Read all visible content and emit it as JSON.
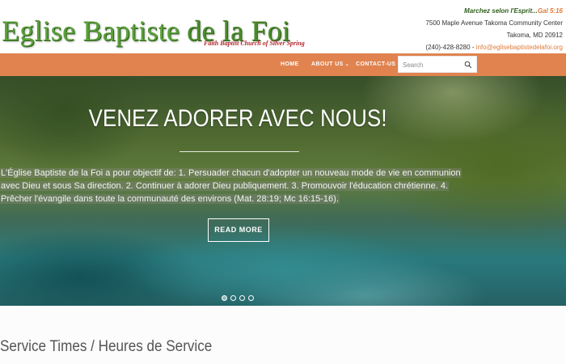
{
  "header": {
    "logo_title_main": "Eglise Baptiste",
    "logo_title_rest": "de la Foi",
    "logo_subtitle": "Faith Baptist Church of Silver Spring",
    "motto": "Marchez selon l'Esprit...",
    "motto_ref": "Gal 5:16",
    "address_line1": "7500 Maple Avenue Takoma Community Center",
    "address_line2": "Takoma, MD 20912",
    "phone": "(240)-428-8280 - ",
    "email": "info@eglisebaptistedelafoi.org"
  },
  "nav": {
    "items": [
      {
        "label": "HOME"
      },
      {
        "label": "ABOUT US"
      },
      {
        "label": "CONTACT-US"
      }
    ],
    "search_placeholder": "Search"
  },
  "hero": {
    "title": "VENEZ ADORER AVEC NOUS!",
    "text": "L'Église Baptiste de la Foi a pour objectif de: 1. Persuader chacun d'adopter un nouveau mode de vie en communion avec Dieu et sous Sa direction. 2. Continuer à adorer Dieu publiquement. 3. Promouvoir l'éducation chrétienne. 4. Prêcher l'évangile dans toute la communauté des environs (Mat. 28:19; Mc 16:15-16).",
    "button_label": "READ MORE",
    "slides": 4,
    "active_slide": 1
  },
  "section": {
    "title": "Service Times / Heures de Service"
  },
  "colors": {
    "nav_bg": "#e0834f",
    "logo_green": "#5aa03a",
    "accent_orange": "#e07a3a"
  }
}
